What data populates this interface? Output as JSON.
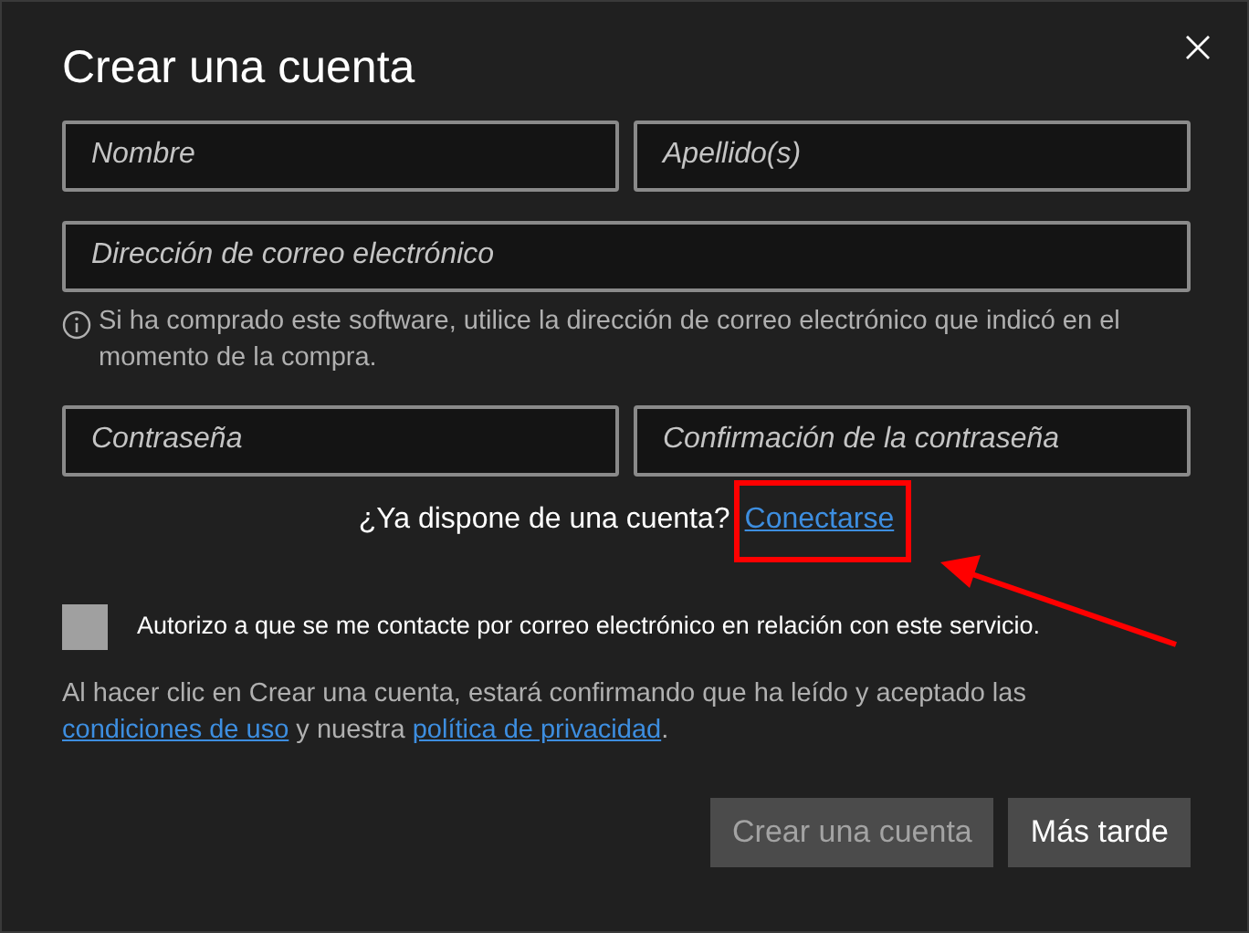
{
  "dialog": {
    "title": "Crear una cuenta",
    "name_fields": [
      {
        "placeholder": "Nombre"
      },
      {
        "placeholder": "Apellido(s)"
      }
    ],
    "email_field": {
      "placeholder": "Dirección de correo electrónico"
    },
    "hint": "Si ha comprado este software, utilice la dirección de correo electrónico que indicó en el momento de la compra.",
    "password_fields": [
      {
        "placeholder": "Contraseña"
      },
      {
        "placeholder": "Confirmación de la contraseña"
      }
    ],
    "login_prompt": {
      "text": "¿Ya dispone de una cuenta?",
      "link": "Conectarse",
      "highlighted": true
    },
    "consent": {
      "label": "Autorizo a que se me contacte por correo electrónico en relación con este servicio.",
      "checked": false
    },
    "terms": [
      {
        "kind": "text",
        "text": "Al hacer clic en Crear una cuenta, estará confirmando que ha leído y aceptado las "
      },
      {
        "kind": "link",
        "text": "condiciones de uso"
      },
      {
        "kind": "text",
        "text": " y nuestra "
      },
      {
        "kind": "link",
        "text": "política de privacidad"
      },
      {
        "kind": "text",
        "text": "."
      }
    ],
    "buttons": [
      {
        "label": "Crear una cuenta",
        "disabled": true
      },
      {
        "label": "Más tarde",
        "disabled": false
      }
    ]
  }
}
